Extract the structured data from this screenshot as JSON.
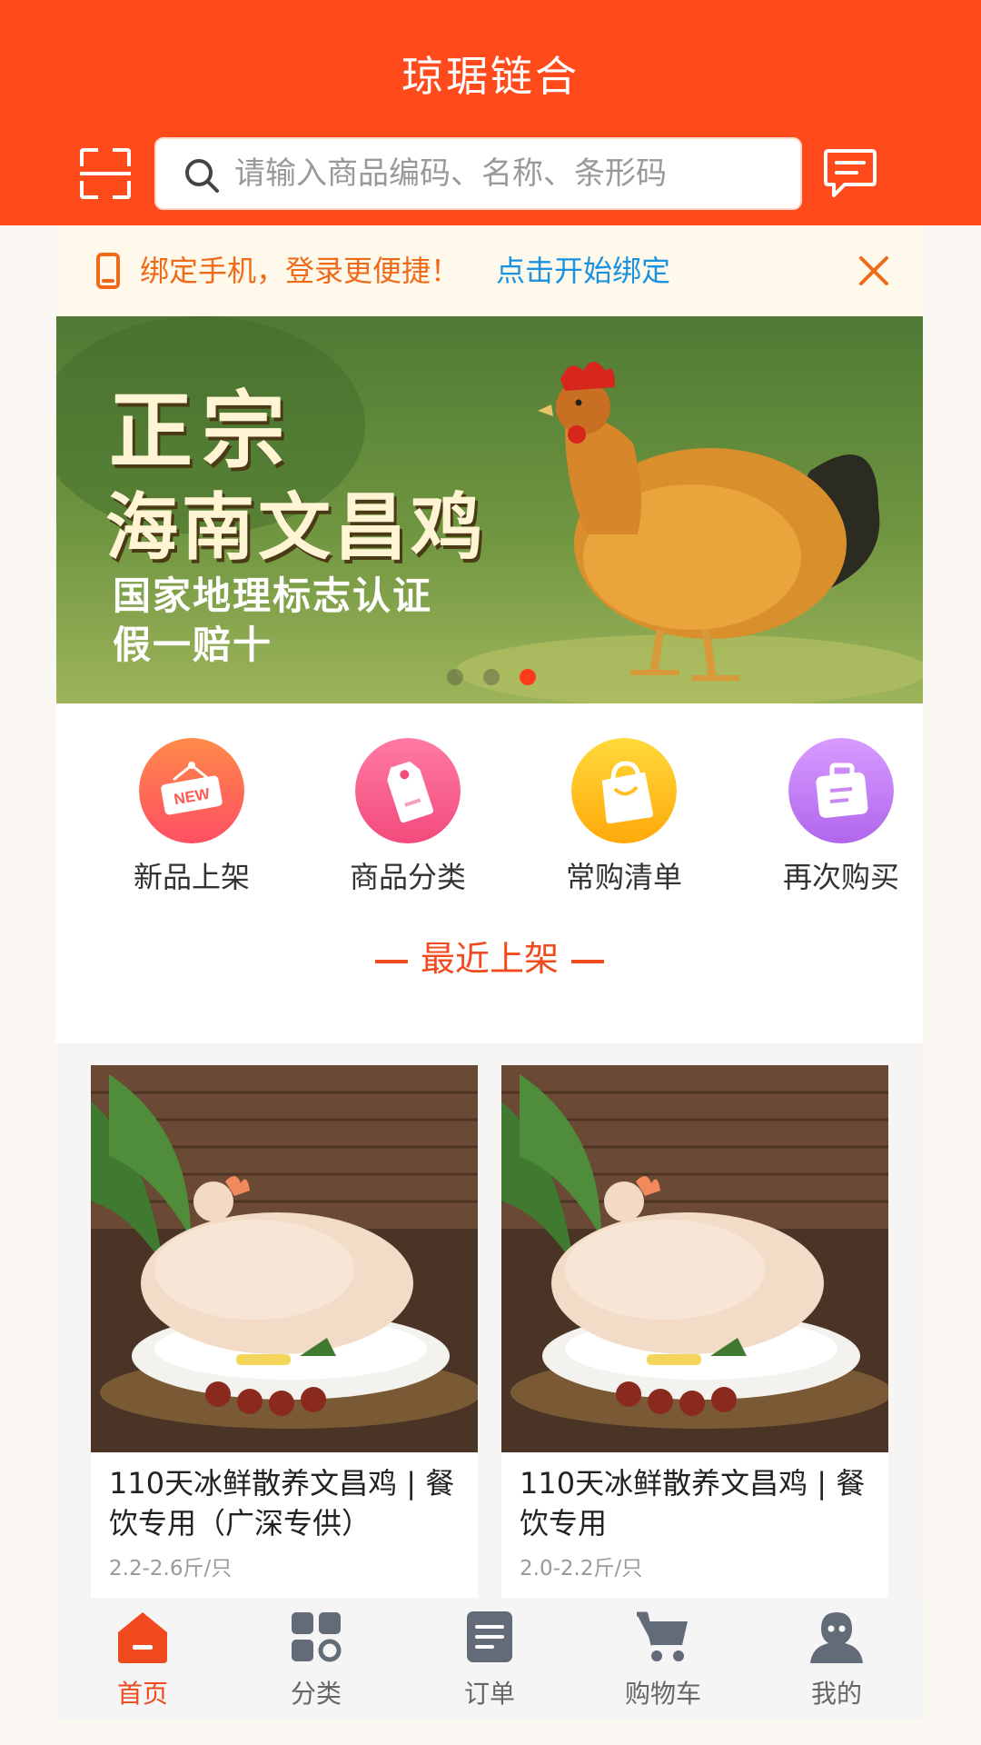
{
  "header": {
    "title": "琼琚链合",
    "search_placeholder": "请输入商品编码、名称、条形码"
  },
  "bind_bar": {
    "text": "绑定手机，登录更便捷！",
    "link": "点击开始绑定"
  },
  "banner": {
    "line1": "正宗",
    "line2": "海南文昌鸡",
    "line3": "国家地理标志认证",
    "line4": "假一赔十",
    "total_slides": 3,
    "active_slide": 3
  },
  "quick_entries": [
    {
      "label": "新品上架",
      "icon": "new-tag-icon",
      "badge": "NEW",
      "color": "#ff6a4d"
    },
    {
      "label": "商品分类",
      "icon": "price-tag-icon",
      "color": "#fb5a8d"
    },
    {
      "label": "常购清单",
      "icon": "shopping-bag-icon",
      "color": "#ffbe16"
    },
    {
      "label": "再次购买",
      "icon": "briefcase-icon",
      "color": "#c07cf2"
    }
  ],
  "section": {
    "title": "最近上架"
  },
  "products": [
    {
      "name": "110天冰鲜散养文昌鸡 | 餐饮专用（广深专供）",
      "spec": "2.2-2.6斤/只"
    },
    {
      "name": "110天冰鲜散养文昌鸡 | 餐饮专用",
      "spec": "2.0-2.2斤/只"
    }
  ],
  "tabbar": {
    "items": [
      {
        "label": "首页",
        "icon": "home-icon"
      },
      {
        "label": "分类",
        "icon": "category-grid-icon"
      },
      {
        "label": "订单",
        "icon": "order-list-icon"
      },
      {
        "label": "购物车",
        "icon": "cart-icon"
      },
      {
        "label": "我的",
        "icon": "user-icon"
      }
    ],
    "active": "首页"
  },
  "colors": {
    "brand": "#ff4a1c",
    "accent": "#f04a1e",
    "link": "#1a92e0",
    "notice_text": "#ef6a19"
  }
}
